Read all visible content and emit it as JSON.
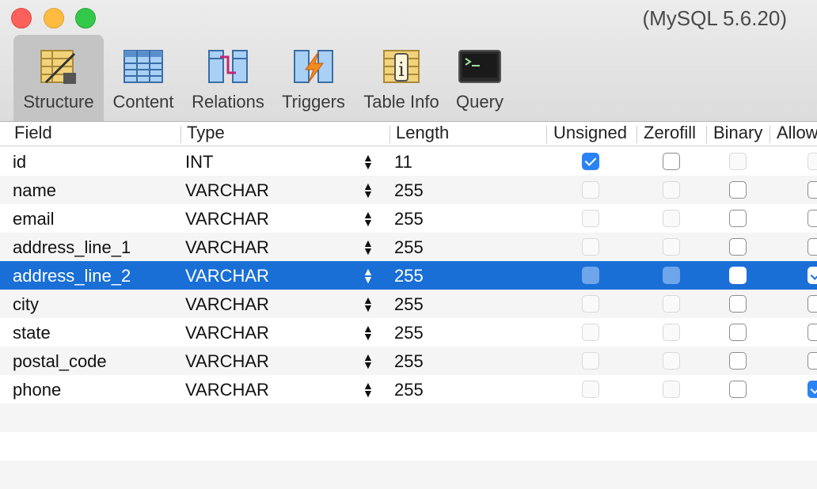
{
  "window": {
    "title": "(MySQL 5.6.20)"
  },
  "toolbar": [
    {
      "label": "Structure",
      "icon": "structure-icon",
      "active": true
    },
    {
      "label": "Content",
      "icon": "content-icon",
      "active": false
    },
    {
      "label": "Relations",
      "icon": "relations-icon",
      "active": false
    },
    {
      "label": "Triggers",
      "icon": "triggers-icon",
      "active": false
    },
    {
      "label": "Table Info",
      "icon": "table-info-icon",
      "active": false
    },
    {
      "label": "Query",
      "icon": "query-icon",
      "active": false
    }
  ],
  "table": {
    "columns": [
      "Field",
      "Type",
      "Length",
      "Unsigned",
      "Zerofill",
      "Binary",
      "Allow"
    ],
    "rows": [
      {
        "field": "id",
        "type": "INT",
        "length": "11",
        "unsigned": true,
        "zerofill": false,
        "binary": false,
        "allow_null": false
      },
      {
        "field": "name",
        "type": "VARCHAR",
        "length": "255",
        "unsigned": false,
        "zerofill": false,
        "binary": false,
        "allow_null": false
      },
      {
        "field": "email",
        "type": "VARCHAR",
        "length": "255",
        "unsigned": false,
        "zerofill": false,
        "binary": false,
        "allow_null": false
      },
      {
        "field": "address_line_1",
        "type": "VARCHAR",
        "length": "255",
        "unsigned": false,
        "zerofill": false,
        "binary": false,
        "allow_null": false
      },
      {
        "field": "address_line_2",
        "type": "VARCHAR",
        "length": "255",
        "unsigned": false,
        "zerofill": false,
        "binary": false,
        "allow_null": true,
        "selected": true
      },
      {
        "field": "city",
        "type": "VARCHAR",
        "length": "255",
        "unsigned": false,
        "zerofill": false,
        "binary": false,
        "allow_null": false
      },
      {
        "field": "state",
        "type": "VARCHAR",
        "length": "255",
        "unsigned": false,
        "zerofill": false,
        "binary": false,
        "allow_null": false
      },
      {
        "field": "postal_code",
        "type": "VARCHAR",
        "length": "255",
        "unsigned": false,
        "zerofill": false,
        "binary": false,
        "allow_null": false
      },
      {
        "field": "phone",
        "type": "VARCHAR",
        "length": "255",
        "unsigned": false,
        "zerofill": false,
        "binary": false,
        "allow_null": true
      }
    ]
  },
  "colors": {
    "selection": "#1a6fd6",
    "checkbox_checked": "#2a83f5"
  }
}
